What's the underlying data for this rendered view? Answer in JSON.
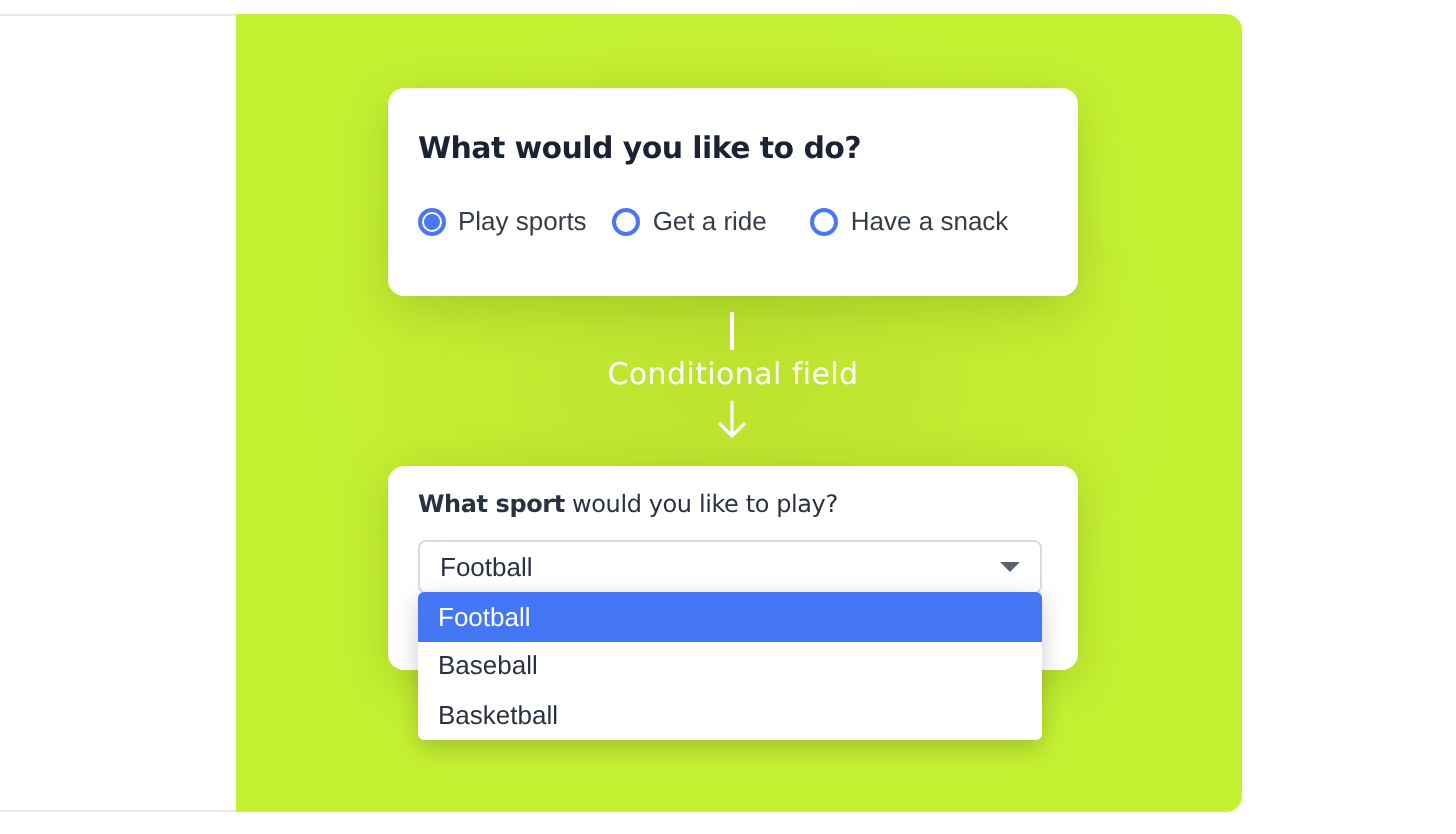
{
  "question": {
    "title": "What would you like to do?",
    "options": [
      {
        "label": "Play sports",
        "selected": true
      },
      {
        "label": "Get a ride",
        "selected": false
      },
      {
        "label": "Have a snack",
        "selected": false
      }
    ]
  },
  "annotation": {
    "label": "Conditional field"
  },
  "followup": {
    "label": "**What sport** would you like to play?",
    "select": {
      "value": "Football",
      "expanded": true
    },
    "options": [
      {
        "label": "Football",
        "selected": true
      },
      {
        "label": "Baseball",
        "selected": false
      },
      {
        "label": "Basketball",
        "selected": false
      }
    ]
  }
}
